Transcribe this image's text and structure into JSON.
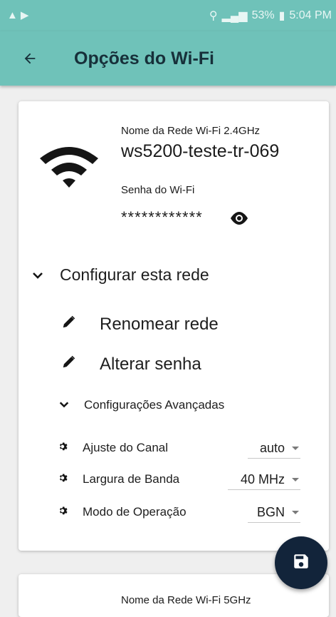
{
  "status_bar": {
    "battery": "53%",
    "time": "5:04 PM"
  },
  "app_bar": {
    "title": "Opções do Wi-Fi"
  },
  "network_24": {
    "name_label": "Nome da Rede Wi-Fi 2.4GHz",
    "name_value": "ws5200-teste-tr-069",
    "password_label": "Senha do Wi-Fi",
    "password_value": "************",
    "configure_label": "Configurar esta rede",
    "rename_label": "Renomear rede",
    "change_password_label": "Alterar senha",
    "advanced_label": "Configurações Avançadas",
    "settings": [
      {
        "label": "Ajuste do Canal",
        "value": "auto"
      },
      {
        "label": "Largura de Banda",
        "value": "40 MHz"
      },
      {
        "label": "Modo de Operação",
        "value": "BGN"
      }
    ]
  },
  "network_5": {
    "name_label": "Nome da Rede Wi-Fi 5GHz"
  },
  "colors": {
    "app_bar": "#6fc2b9",
    "fab": "#12243a",
    "background": "#efefef"
  },
  "icons": [
    "back-arrow-icon",
    "wifi-icon",
    "eye-icon",
    "chevron-down-icon",
    "pencil-icon",
    "gear-icon",
    "save-icon"
  ]
}
